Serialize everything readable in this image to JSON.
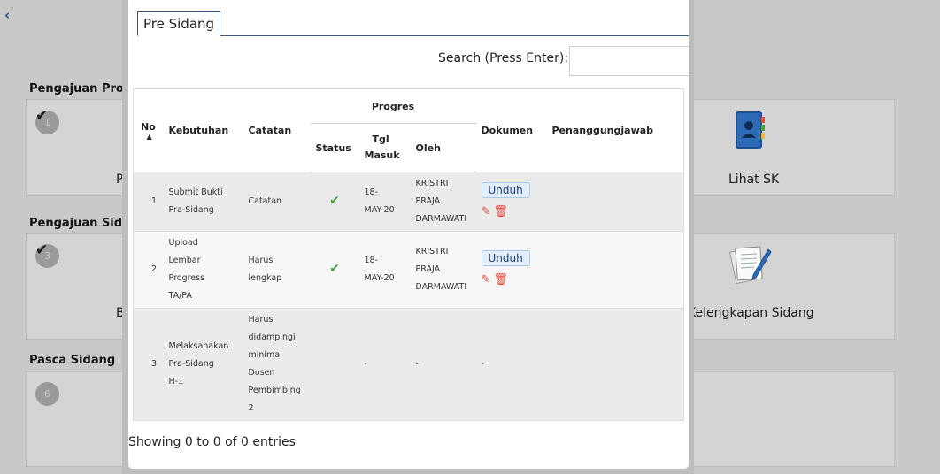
{
  "background": {
    "back_icon": "chevron-left-icon",
    "sections": [
      {
        "title": "Pengajuan Propo",
        "step": "1",
        "card_left_label": "Pe",
        "card_right_label": "Lihat SK",
        "right_icon": "address-book-icon"
      },
      {
        "title": "Pengajuan Sidan",
        "step": "3",
        "card_left_label": "Bi",
        "card_right_label": "Kelengkapan Sidang",
        "right_icon": "document-pencil-icon"
      },
      {
        "title": "Pasca Sidang",
        "step": "6"
      }
    ]
  },
  "modal": {
    "tab_label": "Pre Sidang",
    "search_label": "Search (Press Enter):",
    "search_value": "",
    "table": {
      "headers": {
        "no": "No",
        "kebutuhan": "Kebutuhan",
        "catatan": "Catatan",
        "progres": "Progres",
        "status": "Status",
        "tgl_masuk_1": "Tgl",
        "tgl_masuk_2": "Masuk",
        "oleh": "Oleh",
        "dokumen": "Dokumen",
        "penanggungjawab": "Penanggungjawab"
      },
      "rows": [
        {
          "no": "1",
          "kebutuhan": [
            "Submit Bukti",
            "Pra-Sidang"
          ],
          "catatan": [
            "Catatan"
          ],
          "status": "check",
          "tgl": [
            "18-",
            "MAY-20"
          ],
          "oleh": [
            "KRISTRI",
            "PRAJA",
            "DARMAWATI"
          ],
          "dokumen": "Unduh",
          "penanggungjawab": ""
        },
        {
          "no": "2",
          "kebutuhan": [
            "Upload",
            "Lembar",
            "Progress",
            "TA/PA"
          ],
          "catatan": [
            "Harus",
            "lengkap"
          ],
          "status": "check",
          "tgl": [
            "18-",
            "MAY-20"
          ],
          "oleh": [
            "KRISTRI",
            "PRAJA",
            "DARMAWATI"
          ],
          "dokumen": "Unduh",
          "penanggungjawab": ""
        },
        {
          "no": "3",
          "kebutuhan": [
            "Melaksanakan",
            "Pra-Sidang",
            "H-1"
          ],
          "catatan": [
            "Harus",
            "didampingi",
            "minimal",
            "Dosen",
            "Pembimbing",
            "2"
          ],
          "status": "",
          "tgl": [
            "-"
          ],
          "oleh": [
            "-"
          ],
          "dokumen": "-",
          "penanggungjawab": ""
        }
      ]
    },
    "footer": "Showing 0 to 0 of 0 entries"
  }
}
